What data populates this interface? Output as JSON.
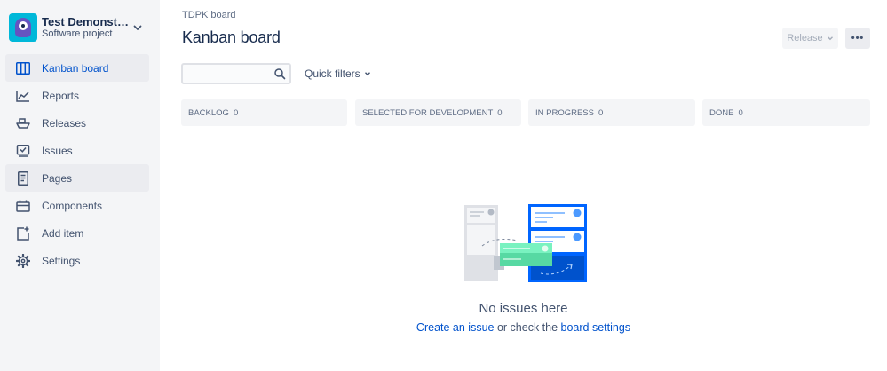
{
  "project": {
    "name": "Test Demonstra...",
    "type": "Software project"
  },
  "sidebar": {
    "items": [
      {
        "label": "Kanban board",
        "icon": "board-icon"
      },
      {
        "label": "Reports",
        "icon": "reports-icon"
      },
      {
        "label": "Releases",
        "icon": "ship-icon"
      },
      {
        "label": "Issues",
        "icon": "issues-icon"
      },
      {
        "label": "Pages",
        "icon": "page-icon"
      },
      {
        "label": "Components",
        "icon": "component-icon"
      },
      {
        "label": "Add item",
        "icon": "add-item-icon"
      },
      {
        "label": "Settings",
        "icon": "gear-icon"
      }
    ]
  },
  "header": {
    "breadcrumb": "TDPK board",
    "title": "Kanban board",
    "release_label": "Release",
    "more_label": "•••"
  },
  "filters": {
    "search_value": "",
    "quick_filters_label": "Quick filters"
  },
  "columns": [
    {
      "name": "BACKLOG",
      "count": "0"
    },
    {
      "name": "SELECTED FOR DEVELOPMENT",
      "count": "0"
    },
    {
      "name": "IN PROGRESS",
      "count": "0"
    },
    {
      "name": "DONE",
      "count": "0"
    }
  ],
  "empty_state": {
    "title": "No issues here",
    "link_create": "Create an issue",
    "middle_text": " or check the ",
    "link_settings": "board settings"
  },
  "colors": {
    "accent": "#0052CC",
    "sidebar_bg": "#F4F5F7",
    "avatar": "#00B8D9",
    "illustration_blue": "#0065FF",
    "illustration_green": "#57D9A3"
  }
}
